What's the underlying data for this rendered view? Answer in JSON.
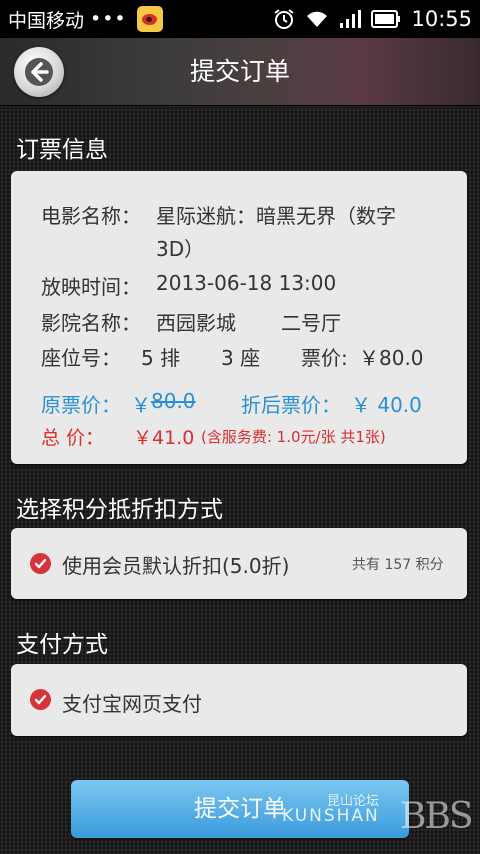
{
  "status_bar": {
    "carrier": "中国移动",
    "dots": "•••",
    "time": "10:55"
  },
  "header": {
    "title": "提交订单"
  },
  "ticket_info": {
    "section_title": "订票信息",
    "movie_label": "电影名称：",
    "movie_name_line1": "星际迷航：暗黑无界（数字",
    "movie_name_line2": "3D）",
    "showtime_label": "放映时间：",
    "showtime": "2013-06-18 13:00",
    "cinema_label": "影院名称：",
    "cinema": "西园影城",
    "hall": "二号厅",
    "seat_label": "座位号：",
    "seat_row": "5 排",
    "seat_col": "3 座",
    "price_label": "票价:",
    "price": "￥80.0",
    "original_label": "原票价：",
    "original_currency": "￥",
    "original_price": "80.0",
    "discount_label": "折后票价：",
    "discount_price": "￥ 40.0",
    "total_label": "总    价：",
    "total": "￥41.0",
    "total_note": "(含服务费: 1.0元/张  共1张)"
  },
  "points": {
    "section_title": "选择积分抵折扣方式",
    "option_label": "使用会员默认折扣(5.0折)",
    "points_note": "共有 157 积分"
  },
  "payment": {
    "section_title": "支付方式",
    "option_label": "支付宝网页支付"
  },
  "footer": {
    "submit_label": "提交订单",
    "watermark_cn": "昆山论坛",
    "watermark_en": "KUNSHAN",
    "watermark_bbs": "BBS"
  },
  "colors": {
    "accent_blue": "#2c8fd4",
    "total_red": "#d9302f",
    "check_red": "#d8333b"
  }
}
